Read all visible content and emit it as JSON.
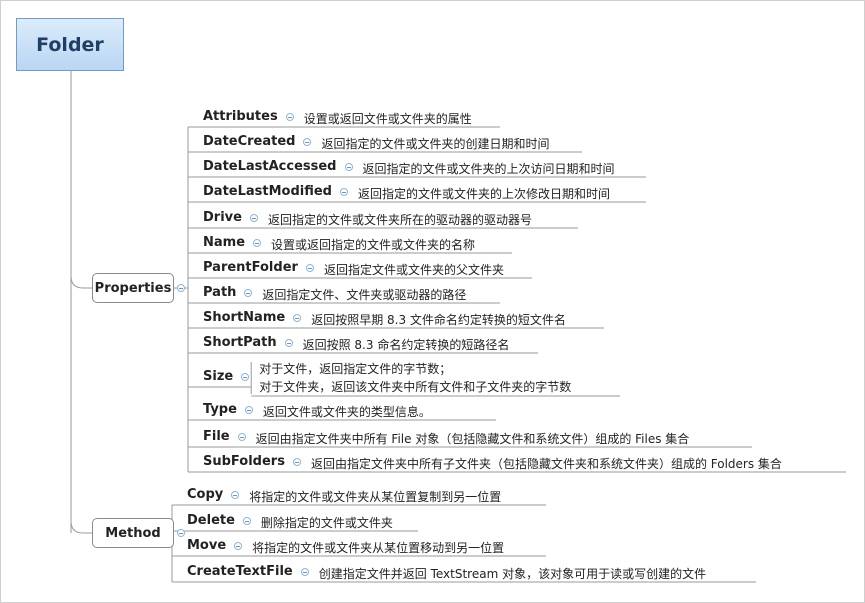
{
  "root": {
    "label": "Folder"
  },
  "groups": [
    {
      "label": "Properties",
      "items": [
        {
          "name": "Attributes",
          "desc": "设置或返回文件或文件夹的属性"
        },
        {
          "name": "DateCreated",
          "desc": "返回指定的文件或文件夹的创建日期和时间"
        },
        {
          "name": "DateLastAccessed",
          "desc": "返回指定的文件或文件夹的上次访问日期和时间"
        },
        {
          "name": "DateLastModified",
          "desc": "返回指定的文件或文件夹的上次修改日期和时间"
        },
        {
          "name": "Drive",
          "desc": "返回指定的文件或文件夹所在的驱动器的驱动器号"
        },
        {
          "name": "Name",
          "desc": "设置或返回指定的文件或文件夹的名称"
        },
        {
          "name": "ParentFolder",
          "desc": "返回指定文件或文件夹的父文件夹"
        },
        {
          "name": "Path",
          "desc": "返回指定文件、文件夹或驱动器的路径"
        },
        {
          "name": "ShortName",
          "desc": "返回按照早期 8.3 文件命名约定转换的短文件名"
        },
        {
          "name": "ShortPath",
          "desc": "返回按照 8.3 命名约定转换的短路径名"
        },
        {
          "name": "Size",
          "desc": "对于文件，返回指定文件的字节数；",
          "desc2": "对于文件夹，返回该文件夹中所有文件和子文件夹的字节数"
        },
        {
          "name": "Type",
          "desc": "返回文件或文件夹的类型信息。"
        },
        {
          "name": "File",
          "desc": "返回由指定文件夹中所有 File 对象（包括隐藏文件和系统文件）组成的 Files 集合"
        },
        {
          "name": "SubFolders",
          "desc": "返回由指定文件夹中所有子文件夹（包括隐藏文件夹和系统文件夹）组成的 Folders 集合"
        }
      ]
    },
    {
      "label": "Method",
      "items": [
        {
          "name": "Copy",
          "desc": "将指定的文件或文件夹从某位置复制到另一位置"
        },
        {
          "name": "Delete",
          "desc": "删除指定的文件或文件夹"
        },
        {
          "name": "Move",
          "desc": "将指定的文件或文件夹从某位置移动到另一位置"
        },
        {
          "name": "CreateTextFile",
          "desc": "创建指定文件并返回 TextStream 对象，该对象可用于读或写创建的文件"
        }
      ]
    }
  ]
}
